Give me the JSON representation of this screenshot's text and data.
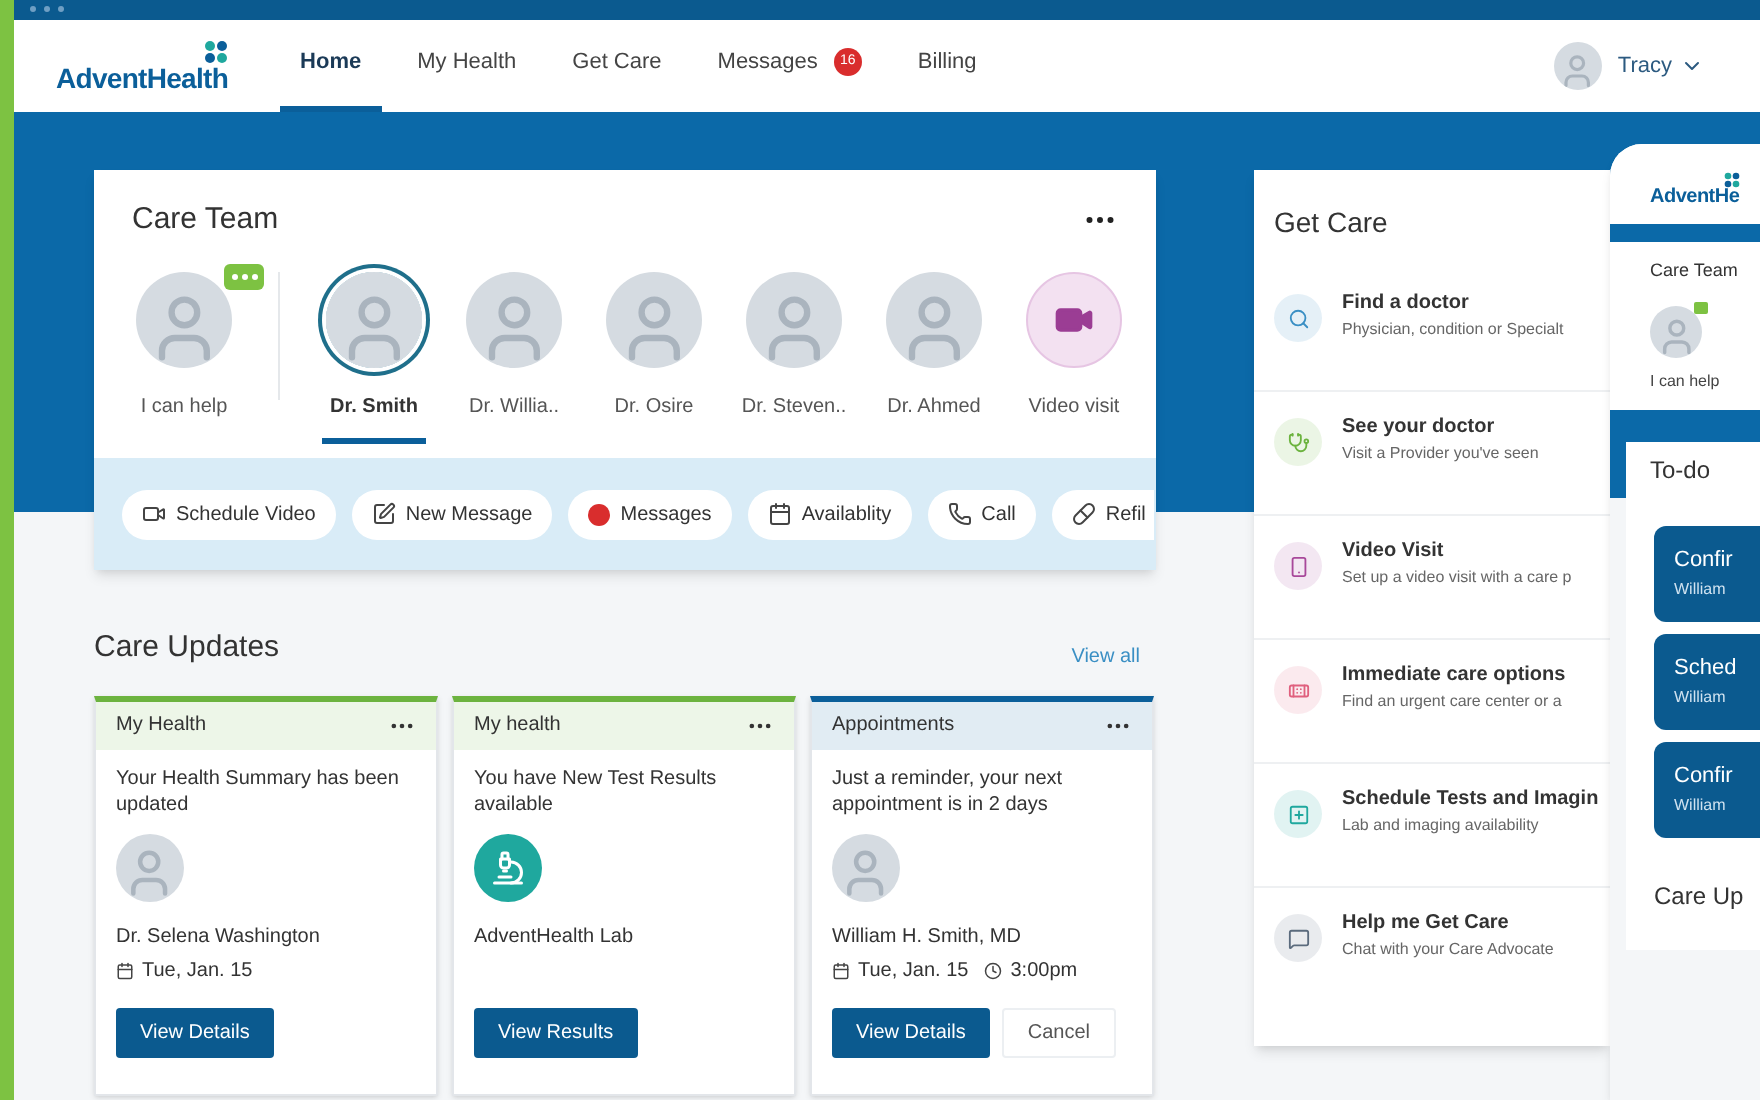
{
  "nav": {
    "logo": "AdventHealth",
    "tabs": [
      {
        "label": "Home",
        "selected": true
      },
      {
        "label": "My Health",
        "selected": false
      },
      {
        "label": "Get Care",
        "selected": false
      },
      {
        "label": "Messages",
        "selected": false,
        "badge": "16"
      },
      {
        "label": "Billing",
        "selected": false
      }
    ],
    "user": {
      "name": "Tracy"
    }
  },
  "care_team": {
    "title": "Care Team",
    "members": [
      {
        "name": "I can help",
        "kind": "assistant",
        "selected": false
      },
      {
        "name": "Dr. Smith",
        "kind": "doctor",
        "selected": true
      },
      {
        "name": "Dr. Willia..",
        "kind": "doctor",
        "selected": false
      },
      {
        "name": "Dr. Osire",
        "kind": "doctor",
        "selected": false
      },
      {
        "name": "Dr. Steven..",
        "kind": "doctor",
        "selected": false
      },
      {
        "name": "Dr. Ahmed",
        "kind": "doctor",
        "selected": false
      },
      {
        "name": "Video visit",
        "kind": "video",
        "selected": false
      }
    ],
    "actions": [
      {
        "label": "Schedule Video",
        "kind": "video"
      },
      {
        "label": "New Message",
        "kind": "message"
      },
      {
        "label": "Messages",
        "kind": "unread"
      },
      {
        "label": "Availablity",
        "kind": "calendar"
      },
      {
        "label": "Call",
        "kind": "phone"
      },
      {
        "label": "Refil",
        "kind": "refill"
      }
    ]
  },
  "care_updates": {
    "title": "Care Updates",
    "view_all": "View all",
    "cards": [
      {
        "category": "My Health",
        "color": "#6cb33f",
        "text": "Your Health Summary has been updated",
        "kind": "person",
        "person": "Dr. Selena Washington",
        "date": "Tue, Jan. 15",
        "buttons": [
          {
            "label": "View Details",
            "kind": "primary"
          }
        ]
      },
      {
        "category": "My health",
        "color": "#6cb33f",
        "text": "You have New Test Results available",
        "kind": "lab",
        "person": "AdventHealth Lab",
        "buttons": [
          {
            "label": "View Results",
            "kind": "primary"
          }
        ]
      },
      {
        "category": "Appointments",
        "color": "#0b5f9a",
        "text": "Just a reminder, your next appointment is in 2 days",
        "kind": "person",
        "person": "William H. Smith, MD",
        "date": "Tue, Jan. 15",
        "time": "3:00pm",
        "buttons": [
          {
            "label": "View Details",
            "kind": "primary"
          },
          {
            "label": "Cancel",
            "kind": "secondary"
          }
        ]
      }
    ]
  },
  "get_care": {
    "title": "Get Care",
    "items": [
      {
        "title": "Find a doctor",
        "subtitle": "Physician, condition or Specialt",
        "kind": "search",
        "color": "#3a8fc4"
      },
      {
        "title": "See your doctor",
        "subtitle": "Visit a Provider you've seen",
        "kind": "doctor",
        "color": "#6cb33f"
      },
      {
        "title": "Video Visit",
        "subtitle": "Set up a video visit with a care p",
        "kind": "video",
        "color": "#a8489a"
      },
      {
        "title": "Immediate care options",
        "subtitle": "Find an urgent care center or a",
        "kind": "urgent",
        "color": "#e0607e"
      },
      {
        "title": "Schedule Tests and Imagin",
        "subtitle": "Lab and imaging availability",
        "kind": "tests",
        "color": "#1fa89e"
      },
      {
        "title": "Help me Get Care",
        "subtitle": "Chat with your Care Advocate",
        "kind": "chat",
        "color": "#5b6b7d"
      }
    ]
  },
  "mobile_preview": {
    "logo": "AdventHe",
    "care_team_title": "Care Team",
    "assistant_label": "I can help",
    "todo_title": "To-do",
    "todos": [
      {
        "title": "Confir",
        "subtitle": "William"
      },
      {
        "title": "Sched",
        "subtitle": "William"
      },
      {
        "title": "Confir",
        "subtitle": "William"
      }
    ],
    "updates_title": "Care Up"
  }
}
